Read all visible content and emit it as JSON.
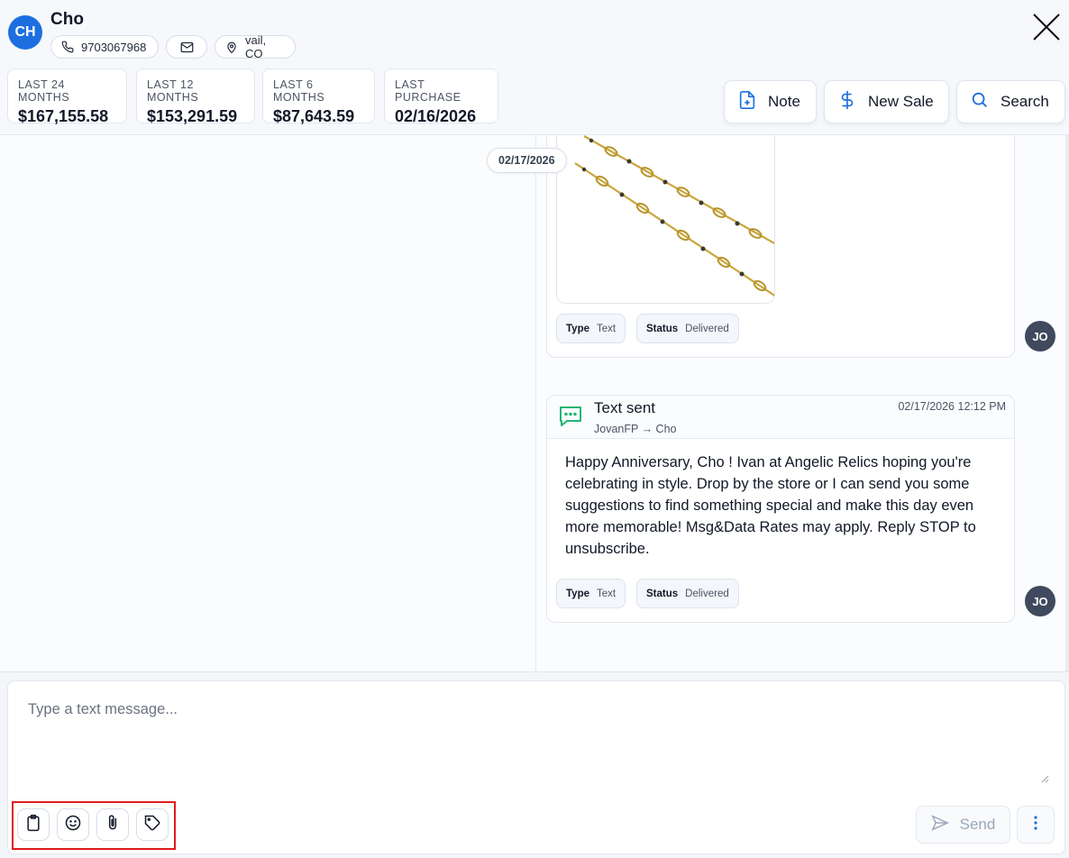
{
  "customer": {
    "initials": "CH",
    "name": "Cho",
    "phone": "9703067968",
    "location": "vail, CO"
  },
  "stats": [
    {
      "label": "LAST 24 MONTHS",
      "value": "$167,155.58"
    },
    {
      "label": "LAST 12 MONTHS",
      "value": "$153,291.59"
    },
    {
      "label": "LAST 6 MONTHS",
      "value": "$87,643.59"
    },
    {
      "label": "LAST PURCHASE",
      "value": "02/16/2026"
    }
  ],
  "actions": {
    "note": "Note",
    "new_sale": "New Sale",
    "search": "Search"
  },
  "conversation": {
    "date_pill": "02/17/2026",
    "image_message": {
      "type_key": "Type",
      "type_value": "Text",
      "status_key": "Status",
      "status_value": "Delivered",
      "sender_initials": "JO"
    },
    "text_message": {
      "title": "Text sent",
      "route": "JovanFP → Cho",
      "timestamp": "02/17/2026 12:12 PM",
      "body": "Happy Anniversary, Cho ! Ivan at Angelic Relics hoping you're celebrating in style. Drop by the store or I can send you some suggestions to find something special and make this day even more memorable! Msg&Data Rates may apply. Reply STOP to unsubscribe.",
      "type_key": "Type",
      "type_value": "Text",
      "status_key": "Status",
      "status_value": "Delivered",
      "sender_initials": "JO"
    }
  },
  "composer": {
    "placeholder": "Type a text message...",
    "send_label": "Send"
  },
  "colors": {
    "brand_blue": "#1d6fe0",
    "success_green": "#22b573",
    "highlight_red": "#e01b1b"
  }
}
